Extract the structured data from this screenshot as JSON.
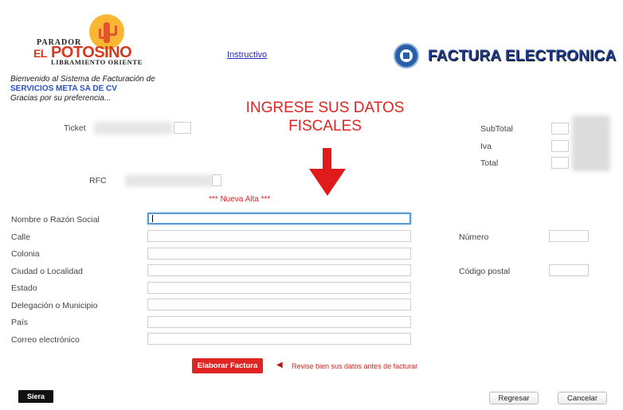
{
  "header": {
    "logo": {
      "top_text": "PARADOR",
      "main_el": "EL",
      "main_name": "POTOSINO",
      "sub_text": "LIBRAMIENTO ORIENTE"
    },
    "instructivo_link": "Instructivo",
    "title": "FACTURA ELECTRONICA"
  },
  "welcome": {
    "line1": "Bienvenido al Sistema de Facturación de",
    "company": "SERVICIOS META SA DE CV",
    "line3": "Gracias por su preferencia..."
  },
  "ticket": {
    "label": "Ticket"
  },
  "rfc": {
    "label": "RFC"
  },
  "totals": {
    "subtotal_label": "SubTotal",
    "iva_label": "Iva",
    "total_label": "Total"
  },
  "banner": {
    "line1": "INGRESE SUS DATOS",
    "line2": "FISCALES"
  },
  "nueva_alta": "*** Nueva Alta ***",
  "form": {
    "fields": [
      {
        "label": "Nombre o Razón Social",
        "value": ""
      },
      {
        "label": "Calle",
        "value": ""
      },
      {
        "label": "Colonia",
        "value": ""
      },
      {
        "label": "Ciudad o Localidad",
        "value": ""
      },
      {
        "label": "Estado",
        "value": ""
      },
      {
        "label": "Delegación o Municipio",
        "value": ""
      },
      {
        "label": "País",
        "value": ""
      },
      {
        "label": "Correo electrónico",
        "value": ""
      }
    ],
    "numero_label": "Número",
    "codigo_postal_label": "Código postal"
  },
  "actions": {
    "elaborar": "Elaborar Factura",
    "note": "Revise bien sus datos antes de facturar",
    "regresar": "Regresar",
    "cancelar": "Cancelar"
  },
  "footer": {
    "brand": "Siera"
  },
  "colors": {
    "accent_red": "#e02424",
    "title_blue": "#1e3a8a",
    "link_blue": "#2a2ac0",
    "company_blue": "#2a4fd0"
  },
  "icons": [
    "logo-sun-cactus",
    "sat-seal-icon",
    "down-arrow-icon",
    "left-arrow-icon"
  ]
}
